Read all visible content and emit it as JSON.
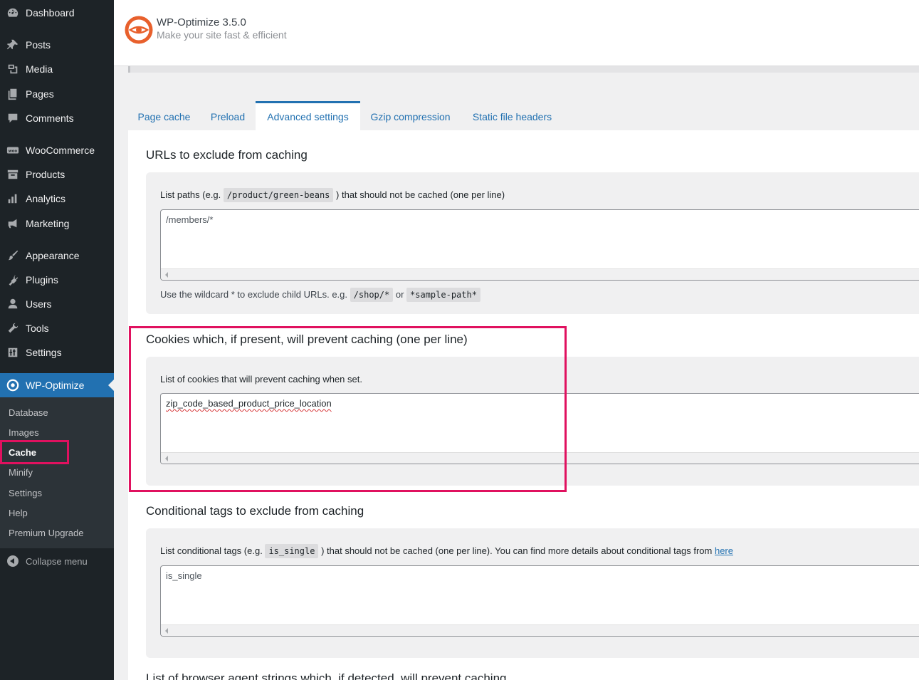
{
  "sidebar": {
    "menu": [
      {
        "label": "Dashboard",
        "icon": "dashboard-icon"
      },
      {
        "label": "Posts",
        "icon": "pin-icon"
      },
      {
        "label": "Media",
        "icon": "media-icon"
      },
      {
        "label": "Pages",
        "icon": "pages-icon"
      },
      {
        "label": "Comments",
        "icon": "comments-icon"
      },
      {
        "label": "WooCommerce",
        "icon": "woo-icon"
      },
      {
        "label": "Products",
        "icon": "archive-icon"
      },
      {
        "label": "Analytics",
        "icon": "bar-chart-icon"
      },
      {
        "label": "Marketing",
        "icon": "megaphone-icon"
      },
      {
        "label": "Appearance",
        "icon": "paintbrush-icon"
      },
      {
        "label": "Plugins",
        "icon": "plugin-icon"
      },
      {
        "label": "Users",
        "icon": "users-icon"
      },
      {
        "label": "Tools",
        "icon": "wrench-icon"
      },
      {
        "label": "Settings",
        "icon": "sliders-icon"
      },
      {
        "label": "WP-Optimize",
        "icon": "wp-optimize-icon"
      }
    ],
    "submenu": [
      "Database",
      "Images",
      "Cache",
      "Minify",
      "Settings",
      "Help",
      "Premium Upgrade"
    ],
    "collapse_label": "Collapse menu"
  },
  "header": {
    "title": "WP-Optimize 3.5.0",
    "subtitle": "Make your site fast & efficient"
  },
  "tabs": [
    "Page cache",
    "Preload",
    "Advanced settings",
    "Gzip compression",
    "Static file headers"
  ],
  "sections": {
    "urls": {
      "title": "URLs to exclude from caching",
      "label_before": "List paths (e.g.",
      "label_code": "/product/green-beans",
      "label_after": ") that should not be cached (one per line)",
      "value": "/members/*",
      "hint_before": "Use the wildcard * to exclude child URLs. e.g.",
      "hint_code1": "/shop/*",
      "hint_or": "or",
      "hint_code2": "*sample-path*"
    },
    "cookies": {
      "title": "Cookies which, if present, will prevent caching (one per line)",
      "label": "List of cookies that will prevent caching when set.",
      "value": "zip_code_based_product_price_location"
    },
    "conditional": {
      "title": "Conditional tags to exclude from caching",
      "label_before": "List conditional tags (e.g.",
      "label_code": "is_single",
      "label_after": ") that should not be cached (one per line). You can find more details about conditional tags from",
      "link": "here",
      "value": "is_single"
    },
    "next_title": "List of browser agent strings which, if detected, will prevent caching"
  },
  "colors": {
    "sidebar_bg": "#1d2327",
    "accent": "#2271b1",
    "highlight": "#e0115f",
    "brand_orange": "#e8602c"
  }
}
